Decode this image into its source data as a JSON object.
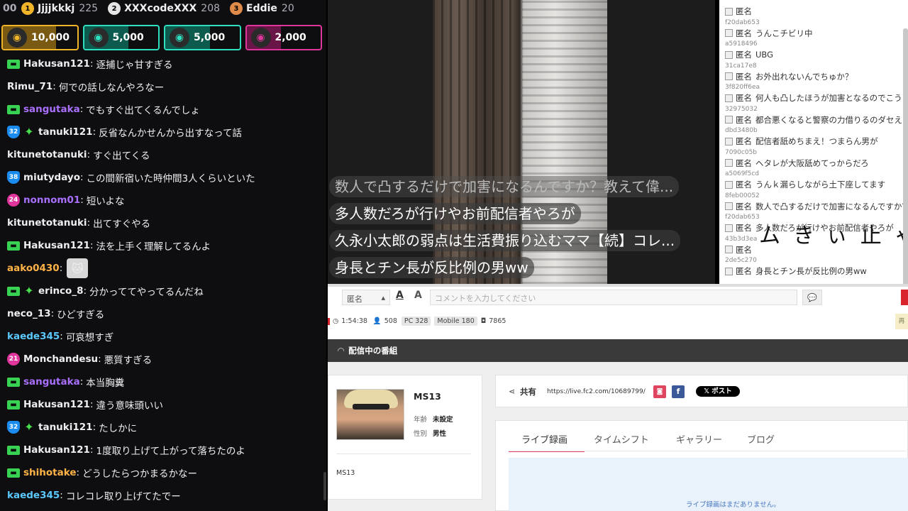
{
  "leaderboard": {
    "fragment": "00",
    "ranks": [
      {
        "rank": "1",
        "name": "Jjjjkkkj",
        "count": "225",
        "color": "#f0b429"
      },
      {
        "rank": "2",
        "name": "XXXcodeXXX",
        "count": "208",
        "color": "#e6e6e6"
      },
      {
        "rank": "3",
        "name": "Eddie",
        "count": "20",
        "color": "#e08a4a"
      }
    ]
  },
  "gifts": [
    {
      "amount": "10,000",
      "border": "#f0b429",
      "fill": "#7a5a12",
      "avatar": "◉"
    },
    {
      "amount": "5,000",
      "border": "#2fe0c0",
      "fill": "#0d5a4e",
      "avatar": "◉"
    },
    {
      "amount": "5,000",
      "border": "#2fe0c0",
      "fill": "#0d5a4e",
      "avatar": "◉"
    },
    {
      "amount": "2,000",
      "border": "#e0359b",
      "fill": "#6a1547",
      "avatar": "◉"
    }
  ],
  "messages": [
    {
      "badges": [
        "sub"
      ],
      "user": "Hakusan121",
      "color": "#efeff1",
      "text": "逐捕じゃ甘すぎる"
    },
    {
      "badges": [],
      "user": "Rimu_71",
      "color": "#efeff1",
      "text": "何での話しなんやろなー"
    },
    {
      "badges": [
        "sub"
      ],
      "user": "sangutaka",
      "color": "#a970ff",
      "text": "でもすぐ出てくるんでしょ"
    },
    {
      "badges": [
        "shield:32",
        "star"
      ],
      "user": "tanuki121",
      "color": "#efeff1",
      "text": "反省なんかせんから出すなって話"
    },
    {
      "badges": [],
      "user": "kitunetotanuki",
      "color": "#efeff1",
      "text": "すぐ出てくる"
    },
    {
      "badges": [
        "shield:38"
      ],
      "user": "miutydayo",
      "color": "#efeff1",
      "text": "この間新宿いた時仲間3人くらいといた"
    },
    {
      "badges": [
        "pink:24"
      ],
      "user": "nonnom01",
      "color": "#a970ff",
      "text": "短いよな"
    },
    {
      "badges": [],
      "user": "kitunetotanuki",
      "color": "#efeff1",
      "text": "出てすぐやる"
    },
    {
      "badges": [
        "sub"
      ],
      "user": "Hakusan121",
      "color": "#efeff1",
      "text": "法を上手く理解してるんよ"
    },
    {
      "badges": [],
      "user": "aako0430",
      "color": "#ffb347",
      "text": "",
      "emote": "🐱"
    },
    {
      "badges": [
        "sub",
        "star"
      ],
      "user": "erinco_8",
      "color": "#efeff1",
      "text": "分かっててやってるんだね"
    },
    {
      "badges": [],
      "user": "neco_13",
      "color": "#efeff1",
      "text": "ひどすぎる"
    },
    {
      "badges": [],
      "user": "kaede345",
      "color": "#5bc8ff",
      "text": "可哀想すぎ"
    },
    {
      "badges": [
        "pink:21"
      ],
      "user": "Monchandesu",
      "color": "#efeff1",
      "text": "悪質すぎる"
    },
    {
      "badges": [
        "sub"
      ],
      "user": "sangutaka",
      "color": "#a970ff",
      "text": "本当胸糞"
    },
    {
      "badges": [
        "sub"
      ],
      "user": "Hakusan121",
      "color": "#efeff1",
      "text": "違う意味頭いい"
    },
    {
      "badges": [
        "shield:32",
        "star"
      ],
      "user": "tanuki121",
      "color": "#efeff1",
      "text": "たしかに"
    },
    {
      "badges": [
        "sub"
      ],
      "user": "Hakusan121",
      "color": "#efeff1",
      "text": "1度取り上げて上がって落ちたのよ"
    },
    {
      "badges": [
        "sub"
      ],
      "user": "shihotake",
      "color": "#ffb347",
      "text": "どうしたらつかまるかなー"
    },
    {
      "badges": [],
      "user": "kaede345",
      "color": "#5bc8ff",
      "text": "コレコレ取り上げてたでー"
    }
  ],
  "danmaku": [
    {
      "text": "数人で凸するだけで加害になるんですか？教えて偉...",
      "dim": true
    },
    {
      "text": "多人数だろが行けやお前配信者やろが",
      "dim": false
    },
    {
      "text": "久永小太郎の弱点は生活費振り込むママ【続】コレ...",
      "dim": false
    },
    {
      "text": "身長とチン長が反比例の男ww",
      "dim": false
    }
  ],
  "comments": [
    {
      "id": "",
      "name": "匿名",
      "text": ""
    },
    {
      "id": "f20dab653",
      "name": "匿名",
      "text": "うんこチビリ中"
    },
    {
      "id": "a5918496",
      "name": "匿名",
      "text": "UBG"
    },
    {
      "id": "31ca17e8",
      "name": "匿名",
      "text": "お外出れないんでちゅか？"
    },
    {
      "id": "3f820ff6ea",
      "name": "匿名",
      "text": "何人も凸したほうが加害となるのでこうい"
    },
    {
      "id": "32975032",
      "name": "匿名",
      "text": "都合悪くなると警察の力借りるのダセえ"
    },
    {
      "id": "dbd3480b",
      "name": "匿名",
      "text": "配信者舐めちまえ！つまらん男が"
    },
    {
      "id": "7090c05b",
      "name": "匿名",
      "text": "ヘタレが大阪舐めてっからだろ"
    },
    {
      "id": "a5069f5cd",
      "name": "匿名",
      "text": "うんｋ漏らしながら土下座してます"
    },
    {
      "id": "8feb00052",
      "name": "匿名",
      "text": "数人で凸するだけで加害になるんですか？"
    },
    {
      "id": "f20dab653",
      "name": "匿名",
      "text": "多人数だろが行けやお前配信者やろが"
    },
    {
      "id": "43b3d3ea",
      "name": "匿名",
      "text": ""
    },
    {
      "id": "2de5c270",
      "name": "匿名",
      "text": "身長とチン長が反比例の男ww"
    }
  ],
  "big_fragment": "ムきぃ止ゃ",
  "input": {
    "name_value": "匿名",
    "font_label": "A",
    "font_size_label": "A",
    "placeholder": "コメントを入力してください",
    "send_icon": "💬"
  },
  "stats": {
    "time": "1:54:38",
    "viewers": "508",
    "pc": "PC 328",
    "mobile": "Mobile 180",
    "total": "7865",
    "tag": "再"
  },
  "stream_header": "配信中の番組",
  "profile": {
    "name": "MS13",
    "age_label": "年齢",
    "age_value": "未設定",
    "sex_label": "性別",
    "sex_value": "男性",
    "bottom_text": "MS13"
  },
  "share": {
    "label": "共有",
    "url": "https://live.fc2.com/10689799/",
    "x_post": "𝕏 ポスト"
  },
  "tabs": [
    "ライブ録画",
    "タイムシフト",
    "ギャラリー",
    "ブログ"
  ],
  "recording_message": "ライブ録画はまだありません。"
}
